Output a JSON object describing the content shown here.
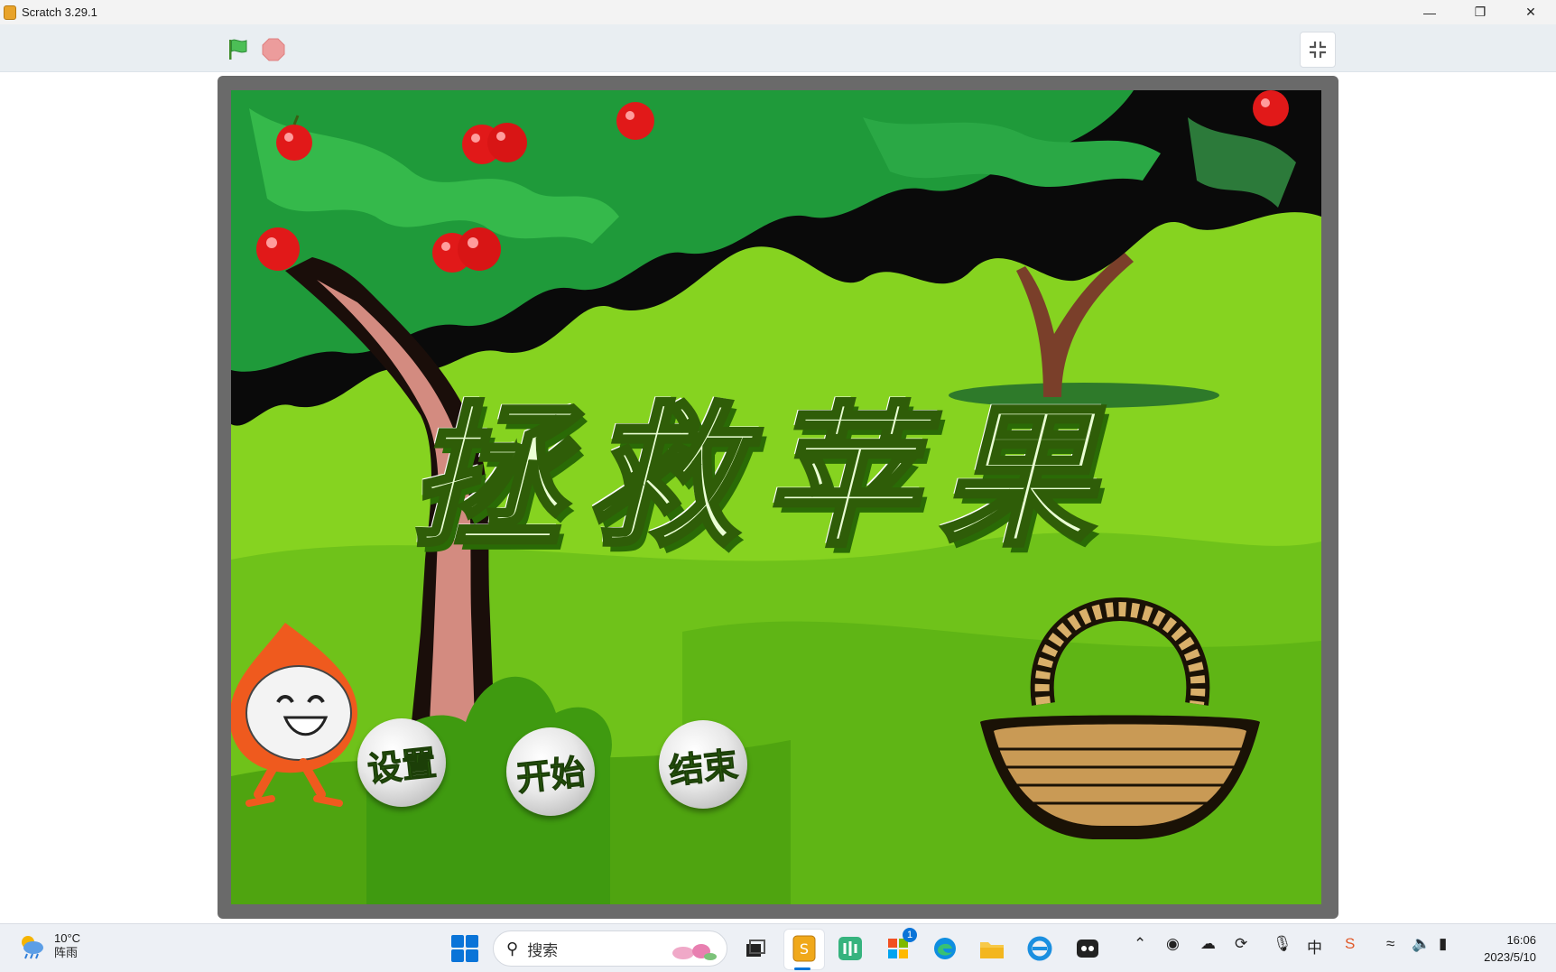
{
  "window": {
    "title": "Scratch 3.29.1",
    "controls": {
      "minimize": "—",
      "restore": "❐",
      "close": "✕"
    }
  },
  "player": {
    "green_flag_icon": "green-flag-icon",
    "stop_icon": "stop-icon",
    "unfullscreen_icon": "unfullscreen-icon"
  },
  "stage": {
    "title": "拯救苹果",
    "buttons": {
      "settings": "设置",
      "start": "开始",
      "end": "结束"
    }
  },
  "taskbar": {
    "weather": {
      "temp": "10°C",
      "condition": "阵雨"
    },
    "search_label": "搜索",
    "store_badge": "1",
    "clock": {
      "time": "16:06",
      "date": "2023/5/10"
    }
  }
}
